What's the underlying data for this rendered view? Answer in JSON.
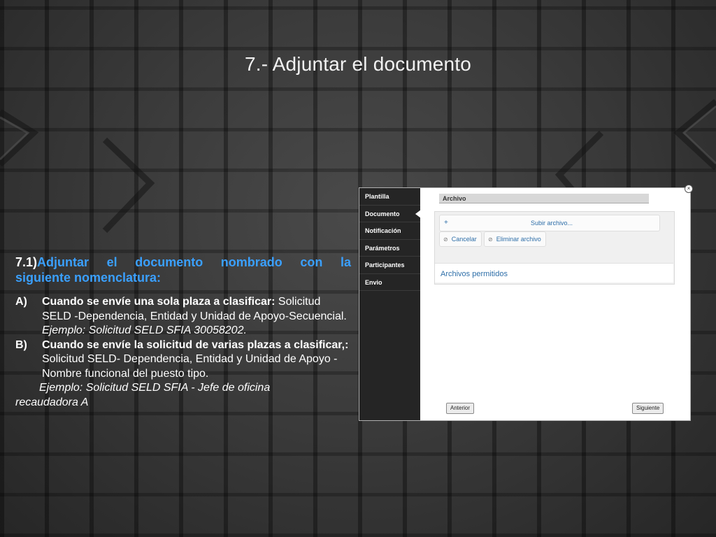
{
  "slide": {
    "title": "7.- Adjuntar el documento"
  },
  "instructions": {
    "heading_number": "7.1)",
    "heading_text_line1": "Adjuntar el documento nombrado con la",
    "heading_text_line2": "siguiente nomenclatura:",
    "item_a": {
      "label": "A)",
      "bold": "Cuando se envíe una sola plaza a clasificar:",
      "text": " Solicitud SELD -Dependencia, Entidad y Unidad de Apoyo-Secuencial.",
      "example": "Ejemplo: Solicitud SELD SFIA 30058202."
    },
    "item_b": {
      "label": "B)",
      "bold": "Cuando se envíe la solicitud de varias plazas a clasificar,:",
      "text": " Solicitud SELD- Dependencia, Entidad y Unidad de Apoyo -Nombre funcional del puesto tipo.",
      "example_line1": "Ejemplo: Solicitud SELD SFIA - Jefe de oficina",
      "example_line2": "recaudadora A"
    }
  },
  "screenshot": {
    "sidebar": {
      "items": [
        {
          "label": "Plantilla"
        },
        {
          "label": "Documento"
        },
        {
          "label": "Notificación"
        },
        {
          "label": "Parámetros"
        },
        {
          "label": "Participantes"
        },
        {
          "label": "Envio"
        }
      ],
      "active_index": 1
    },
    "archivo": {
      "header": "Archivo",
      "upload_label": "Subir archivo...",
      "cancel_label": "Cancelar",
      "delete_label": "Eliminar archivo",
      "allowed_label": "Archivos permitidos"
    },
    "nav": {
      "prev_label": "Anterior",
      "next_label": "Siguiente"
    },
    "icons": {
      "close": "close-icon",
      "plus": "plus-icon",
      "cancel": "cancel-icon",
      "delete": "delete-icon"
    }
  }
}
